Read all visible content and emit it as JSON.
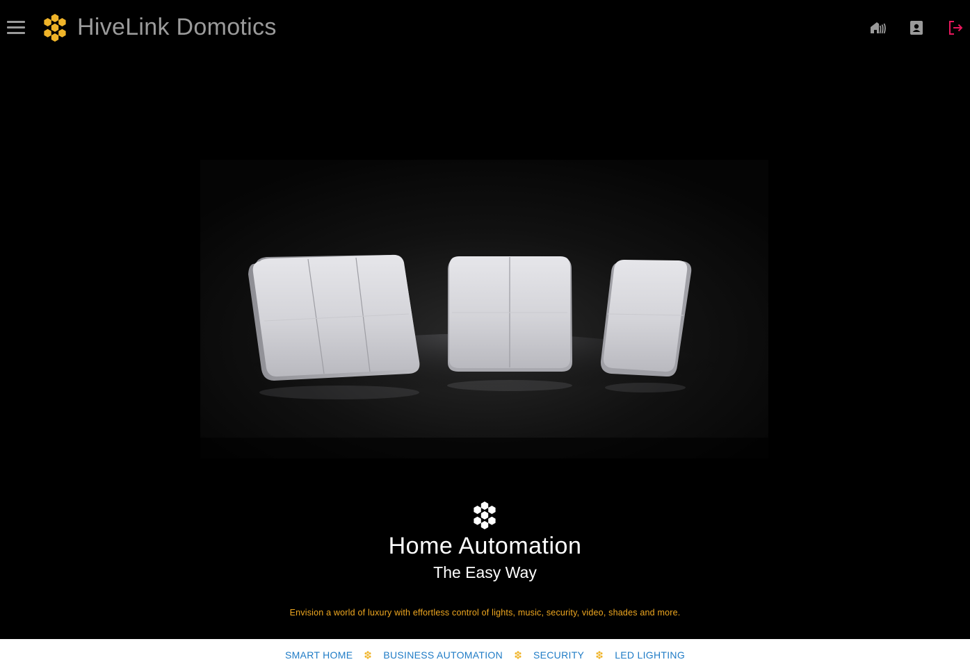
{
  "header": {
    "brand": "HiveLink Domotics",
    "icons": [
      "menu-icon",
      "honeycomb-logo-icon",
      "home-wifi-icon",
      "contact-card-icon",
      "logout-icon"
    ],
    "logout_color": "#e8175d"
  },
  "hero": {
    "image_description_icon": "smart-switches-image",
    "title": "Home Automation",
    "subtitle": "The Easy Way",
    "tagline": "Envision a world of luxury with effortless control of lights, music, security, video, shades and more."
  },
  "footer_nav": {
    "items": [
      {
        "label": "SMART HOME"
      },
      {
        "label": "BUSINESS AUTOMATION"
      },
      {
        "label": "SECURITY"
      },
      {
        "label": "LED LIGHTING"
      }
    ],
    "link_color": "#1e7bc6",
    "separator_icon": "honeycomb-icon"
  },
  "colors": {
    "accent": "#f0b429",
    "background": "#000000",
    "brand_text": "#9b9b9b",
    "tagline": "#f0a820"
  }
}
